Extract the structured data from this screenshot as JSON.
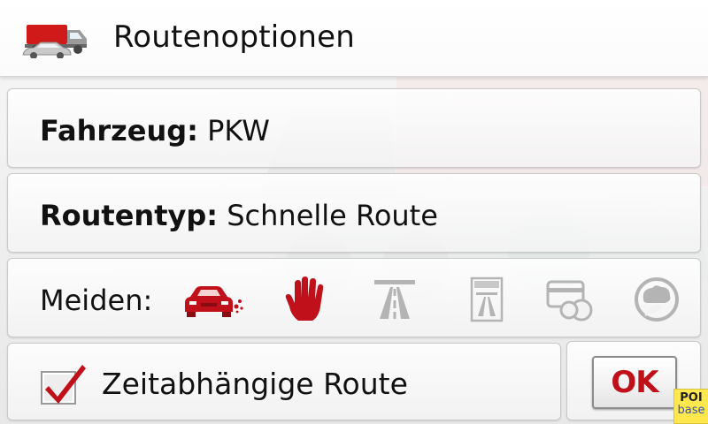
{
  "header": {
    "title": "Routenoptionen",
    "icon": "truck-car-icon"
  },
  "vehicle": {
    "label": "Fahrzeug:",
    "value": "PKW"
  },
  "route_type": {
    "label": "Routentyp:",
    "value": "Schnelle Route"
  },
  "avoid": {
    "label": "Meiden:",
    "icons": [
      {
        "name": "traffic-jam-icon",
        "active": true
      },
      {
        "name": "hand-stop-icon",
        "active": true
      },
      {
        "name": "motorway-icon",
        "active": false
      },
      {
        "name": "toll-road-icon",
        "active": false
      },
      {
        "name": "toll-card-icon",
        "active": false
      },
      {
        "name": "eco-zone-icon",
        "active": false
      }
    ]
  },
  "time_dependent": {
    "label": "Zeitabhängige Route",
    "checked": true
  },
  "ok_button": {
    "label": "OK"
  },
  "badge": {
    "line1": "POI",
    "line2": "base"
  },
  "colors": {
    "active_red": "#c0101a",
    "inactive_gray": "#b4b4b4"
  }
}
